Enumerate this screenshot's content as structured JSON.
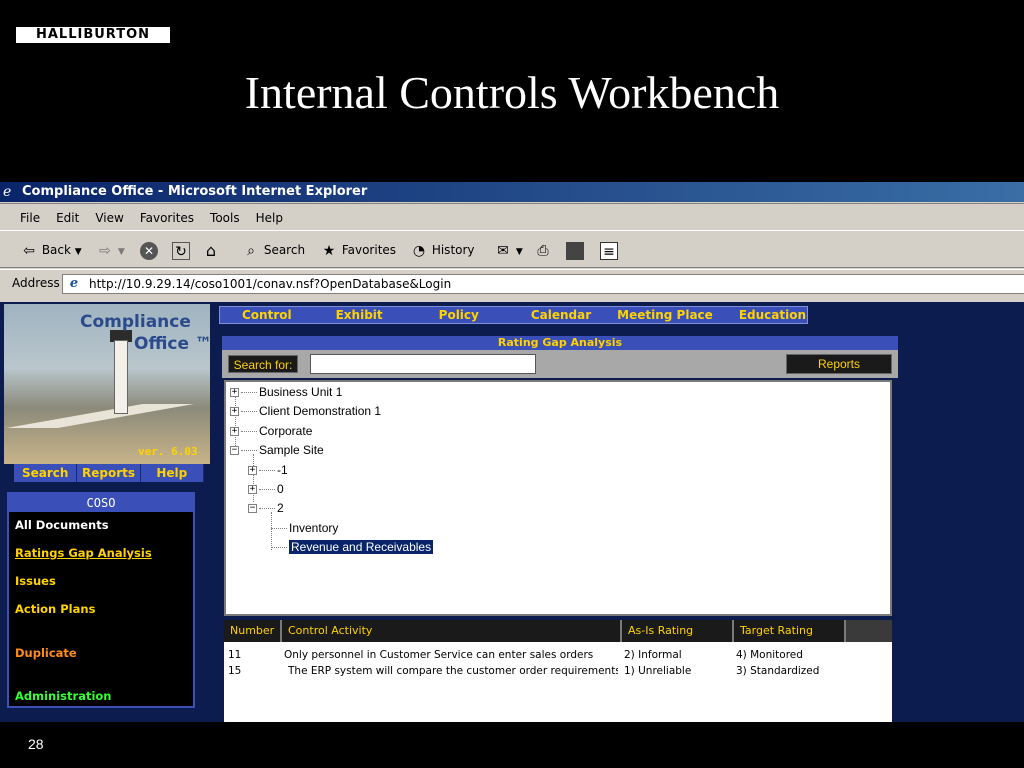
{
  "slide": {
    "logo_text": "HALLIBURTON",
    "title": "Internal Controls Workbench",
    "page_number": "28"
  },
  "window": {
    "title": "Compliance Office - Microsoft Internet Explorer"
  },
  "menu": [
    "File",
    "Edit",
    "View",
    "Favorites",
    "Tools",
    "Help"
  ],
  "toolbar": {
    "back_label": "Back",
    "search_label": "Search",
    "favorites_label": "Favorites",
    "history_label": "History"
  },
  "address": {
    "label": "Address",
    "url": "http://10.9.29.14/coso1001/conav.nsf?OpenDatabase&Login"
  },
  "sidebar": {
    "brand_line1": "Compliance",
    "brand_line2": "Office ™",
    "version": "ver. 6.03",
    "nav": [
      "Search",
      "Reports",
      "Help"
    ],
    "panel_title": "COSO",
    "items": [
      {
        "label": "All Documents",
        "color": "#ffffff"
      },
      {
        "label": "Ratings Gap Analysis",
        "color": "#ffd200"
      },
      {
        "label": "Issues",
        "color": "#ffd200"
      },
      {
        "label": "Action Plans",
        "color": "#ffd200"
      },
      {
        "label": "Duplicate",
        "color": "#ff8c1a"
      },
      {
        "label": "Administration",
        "color": "#33ff33"
      }
    ]
  },
  "top_nav": [
    "Control",
    "Exhibit",
    "Policy",
    "Calendar",
    "Meeting Place",
    "Education"
  ],
  "rating_gap": {
    "header": "Rating Gap Analysis",
    "search_label": "Search for:",
    "search_value": "",
    "reports_label": "Reports"
  },
  "tree": {
    "nodes": [
      {
        "label": "Business Unit 1",
        "toggle": "+"
      },
      {
        "label": "Client Demonstration 1",
        "toggle": "+"
      },
      {
        "label": "Corporate",
        "toggle": "+"
      },
      {
        "label": "Sample Site",
        "toggle": "−"
      },
      {
        "label": "-1",
        "toggle": "+"
      },
      {
        "label": "0",
        "toggle": "+"
      },
      {
        "label": "2",
        "toggle": "−"
      },
      {
        "label": "Inventory",
        "toggle": ""
      },
      {
        "label": "Revenue and Receivables",
        "toggle": ""
      }
    ]
  },
  "table": {
    "headers": [
      "Number",
      "Control Activity",
      "As-Is Rating",
      "Target Rating"
    ],
    "rows": [
      {
        "number": "11",
        "activity": "Only personnel in Customer Service can enter sales orders",
        "as_is": "2) Informal",
        "target": "4) Monitored"
      },
      {
        "number": "15",
        "activity": "The ERP system will compare the customer order requirements",
        "as_is": "1) Unreliable",
        "target": "3) Standardized"
      }
    ]
  },
  "colors": {
    "accent_yellow": "#ffd200",
    "nav_blue": "#3a50b8",
    "page_navy": "#0c1c4e",
    "selection_blue": "#0a246a"
  }
}
